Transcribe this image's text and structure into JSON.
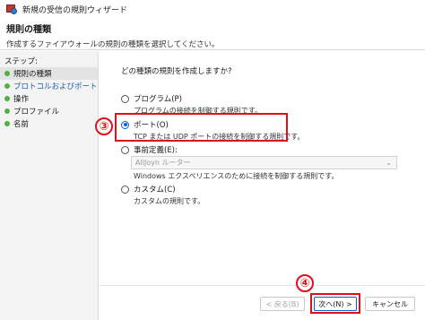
{
  "window": {
    "title": "新規の受信の規則ウィザード"
  },
  "header": {
    "title": "規則の種類",
    "description": "作成するファイアウォールの規則の種類を選択してください。"
  },
  "steps": {
    "label": "ステップ:",
    "items": [
      {
        "label": "規則の種類"
      },
      {
        "label": "プロトコルおよびポート"
      },
      {
        "label": "操作"
      },
      {
        "label": "プロファイル"
      },
      {
        "label": "名前"
      }
    ]
  },
  "main": {
    "question": "どの種類の規則を作成しますか?",
    "options": [
      {
        "label": "プログラム(P)",
        "description": "プログラムの接続を制御する規則です。",
        "selected": false
      },
      {
        "label": "ポート(O)",
        "description": "TCP または UDP ポートの接続を制御する規則です。",
        "selected": true
      },
      {
        "label": "事前定義(E):",
        "description": "Windows エクスペリエンスのために接続を制御する規則です。",
        "selected": false
      },
      {
        "label": "カスタム(C)",
        "description": "カスタムの規則です。",
        "selected": false
      }
    ],
    "predefined_select": {
      "value": "AllJoyn ルーター"
    }
  },
  "annotations": {
    "step3": "③",
    "step4": "④"
  },
  "buttons": {
    "back": "< 戻る(B)",
    "next": "次へ(N) >",
    "cancel": "キャンセル"
  },
  "colors": {
    "accent": "#0a5fd0",
    "annotation_red": "#e0101a",
    "step_dot_green": "#4fb144",
    "current_step_blue": "#1a5fb4"
  }
}
